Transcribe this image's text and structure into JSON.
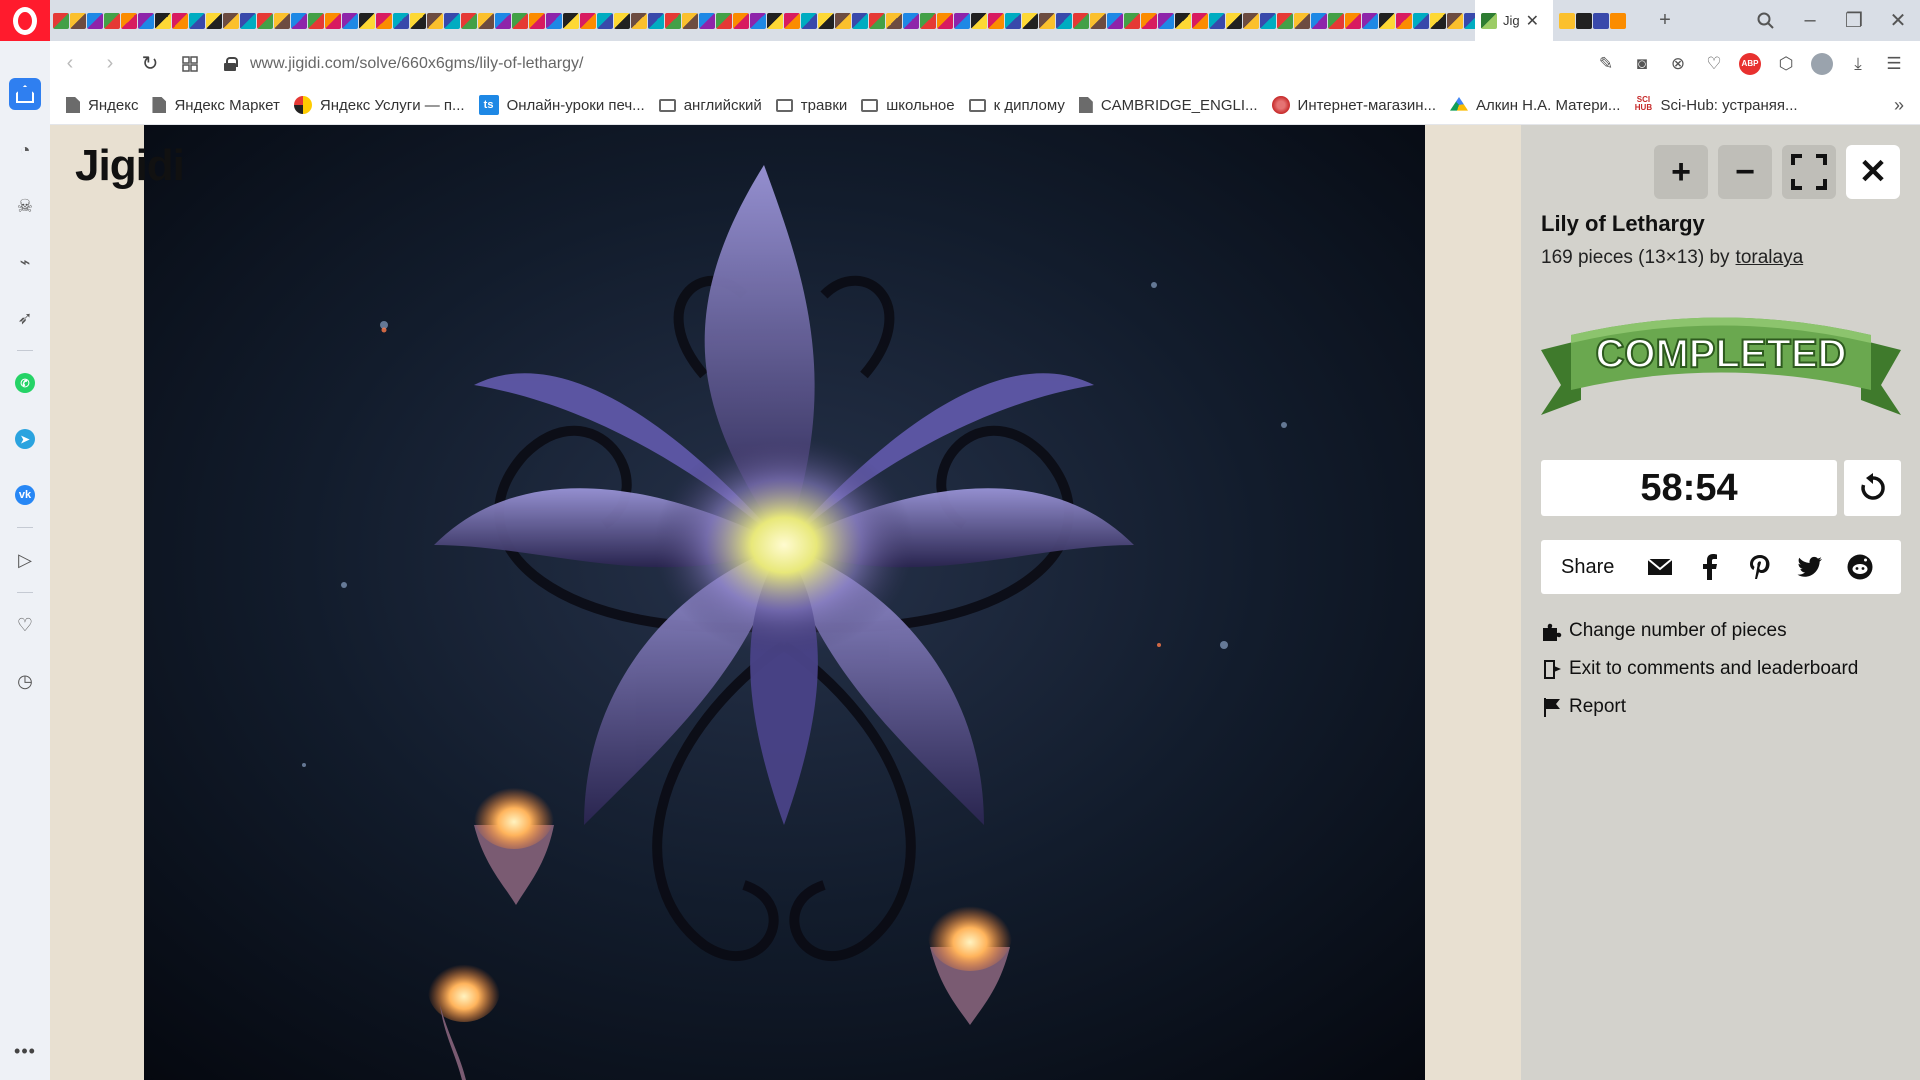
{
  "browser": {
    "active_tab_title": "Jig",
    "url": "www.jigidi.com/solve/660x6gms/lily-of-lethargy/",
    "tab_favicon_colors": [
      "#e53935",
      "#fbc02d",
      "#1e88e5",
      "#43a047",
      "#fb8c00",
      "#8e24aa",
      "#212121",
      "#d81b60",
      "#00acc1",
      "#fdd835",
      "#6d4c41",
      "#3949ab"
    ]
  },
  "bookmarks": [
    {
      "label": "Яндекс",
      "icon": "doc"
    },
    {
      "label": "Яндекс Маркет",
      "icon": "doc"
    },
    {
      "label": "Яндекс Услуги — п...",
      "icon": "yu"
    },
    {
      "label": "Онлайн-уроки печ...",
      "icon": "ts"
    },
    {
      "label": "английский",
      "icon": "folder"
    },
    {
      "label": "травки",
      "icon": "folder"
    },
    {
      "label": "школьное",
      "icon": "folder"
    },
    {
      "label": "к диплому",
      "icon": "folder"
    },
    {
      "label": "CAMBRIDGE_ENGLI...",
      "icon": "doc"
    },
    {
      "label": "Интернет-магазин...",
      "icon": "shop"
    },
    {
      "label": "Алкин Н.А. Матери...",
      "icon": "gd"
    },
    {
      "label": "Sci-Hub: устраняя...",
      "icon": "sci"
    }
  ],
  "site": {
    "logo": "Jigidi"
  },
  "puzzle": {
    "title": "Lily of Lethargy",
    "pieces_text": "169 pieces (13×13) by",
    "author": "toralaya",
    "status_banner": "COMPLETED",
    "timer": "58:54",
    "share_label": "Share",
    "actions": {
      "change_pieces": "Change number of pieces",
      "exit": "Exit to comments and leaderboard",
      "report": "Report"
    }
  },
  "icons": {
    "zoom_in": "+",
    "zoom_out": "−",
    "close": "✕"
  }
}
